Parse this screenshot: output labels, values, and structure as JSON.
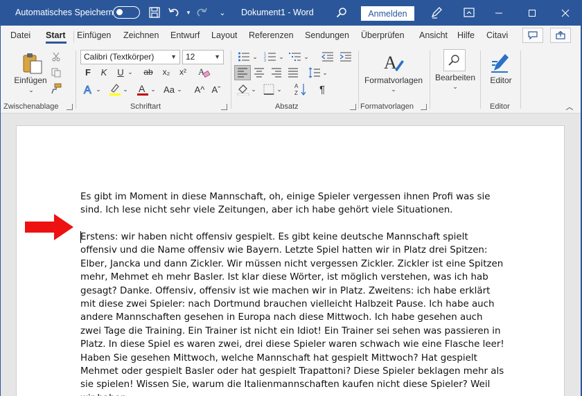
{
  "titlebar": {
    "autosave_label": "Automatisches Speichern",
    "doc_title": "Dokument1  -  Word",
    "signin_label": "Anmelden",
    "icons": [
      "save-icon",
      "undo-icon",
      "redo-icon",
      "customize-toolbar-icon",
      "search-icon",
      "pen-icon",
      "ribbon-display-icon",
      "minimize-icon",
      "maximize-icon",
      "close-icon"
    ]
  },
  "tabs": [
    "Datei",
    "Start",
    "Einfügen",
    "Zeichnen",
    "Entwurf",
    "Layout",
    "Referenzen",
    "Sendungen",
    "Überprüfen",
    "Ansicht",
    "Hilfe",
    "Citavi"
  ],
  "ribbon": {
    "clipboard": {
      "label": "Zwischenablage",
      "paste_label": "Einfügen"
    },
    "font": {
      "label": "Schriftart",
      "font_name": "Calibri (Textkörper)",
      "font_size": "12",
      "bold": "F",
      "italic": "K",
      "underline": "U",
      "strikethrough": "ab",
      "subscript": "x₂",
      "superscript": "x²",
      "case": "Aa",
      "grow": "A^",
      "shrink": "Aˇ",
      "highlight_color": "#ffff00",
      "font_color": "#c00000"
    },
    "paragraph": {
      "label": "Absatz"
    },
    "styles": {
      "label": "Formatvorlagen",
      "button_label": "Formatvorlagen"
    },
    "editing": {
      "label": "",
      "button_label": "Bearbeiten"
    },
    "editor": {
      "label": "Editor",
      "button_label": "Editor"
    }
  },
  "document": {
    "paragraph1": "Es gibt im Moment in diese Mannschaft, oh, einige Spieler vergessen ihnen Profi was sie sind. Ich lese nicht sehr viele Zeitungen, aber ich habe gehört viele Situationen.",
    "paragraph2": "Erstens: wir haben nicht offensiv gespielt. Es gibt keine deutsche Mannschaft spielt offensiv und die Name offensiv wie Bayern. Letzte Spiel hatten wir in Platz drei Spitzen: Elber, Jancka und dann Zickler. Wir müssen nicht vergessen Zickler. Zickler ist eine Spitzen mehr, Mehmet eh mehr Basler. Ist klar diese Wörter, ist möglich verstehen, was ich hab gesagt? Danke. Offensiv, offensiv ist wie machen wir in Platz. Zweitens: ich habe erklärt mit diese zwei Spieler: nach Dortmund brauchen vielleicht Halbzeit Pause. Ich habe auch andere Mannschaften gesehen in Europa nach diese Mittwoch. Ich habe gesehen auch zwei Tage die Training. Ein Trainer ist nicht ein Idiot! Ein Trainer sei sehen was passieren in Platz. In diese Spiel es waren zwei, drei diese Spieler waren schwach wie eine Flasche leer! Haben Sie gesehen Mittwoch, welche Mannschaft hat gespielt Mittwoch? Hat gespielt Mehmet oder gespielt Basler oder hat gespielt Trapattoni? Diese Spieler beklagen mehr als sie spielen! Wissen Sie, warum die Italienmannschaften kaufen nicht diese Spieler? Weil wir haben",
    "arrow_color": "#ee1111"
  },
  "colors": {
    "brand": "#2b579a",
    "ribbon_bg": "#f3f3f3"
  }
}
